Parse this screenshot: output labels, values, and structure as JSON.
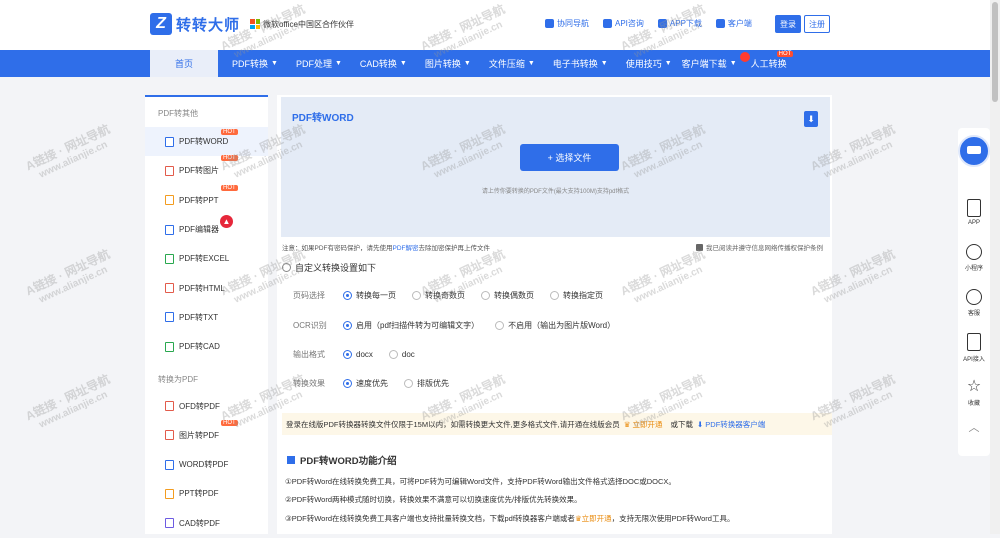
{
  "brand": {
    "logo_letter": "Z",
    "name": "转转大师",
    "partner": "微软office中国区合作伙伴"
  },
  "top_links": [
    "协同导航",
    "API咨询",
    "APP下载",
    "客户端"
  ],
  "auth": {
    "login": "登录",
    "register": "注册"
  },
  "nav": {
    "home": "首页",
    "items": [
      "PDF转换",
      "PDF处理",
      "CAD转换",
      "图片转换",
      "文件压缩",
      "电子书转换",
      "使用技巧",
      "客户端下载",
      "人工转换"
    ],
    "hot_label": "HOT"
  },
  "sidebar": {
    "section1": "PDF转其他",
    "items1": [
      {
        "label": "PDF转WORD",
        "badge": "HOT"
      },
      {
        "label": "PDF转图片",
        "badge": "HOT"
      },
      {
        "label": "PDF转PPT",
        "badge": "HOT"
      },
      {
        "label": "PDF编辑器",
        "badge": "flame"
      },
      {
        "label": "PDF转EXCEL",
        "badge": ""
      },
      {
        "label": "PDF转HTML",
        "badge": ""
      },
      {
        "label": "PDF转TXT",
        "badge": ""
      },
      {
        "label": "PDF转CAD",
        "badge": ""
      }
    ],
    "section2": "转换为PDF",
    "items2": [
      {
        "label": "OFD转PDF",
        "badge": ""
      },
      {
        "label": "图片转PDF",
        "badge": "HOT"
      },
      {
        "label": "WORD转PDF",
        "badge": ""
      },
      {
        "label": "PPT转PDF",
        "badge": ""
      },
      {
        "label": "CAD转PDF",
        "badge": ""
      }
    ]
  },
  "upload": {
    "title": "PDF转WORD",
    "button": "+ 选择文件",
    "hint": "请上传你要转换的PDF文件(最大支持100M)支持pdf格式"
  },
  "note": {
    "prefix": "注意：如果PDF有密码保护，请先使用",
    "link": "PDF解密",
    "suffix": "去除加密保护再上传文件",
    "agree": "我已阅读并遵守信息网络传播权保护条例"
  },
  "settings": {
    "title": "自定义转换设置如下",
    "rows": [
      {
        "label": "页码选择",
        "options": [
          "转换每一页",
          "转换奇数页",
          "转换偶数页",
          "转换指定页"
        ],
        "selected": 0
      },
      {
        "label": "OCR识别",
        "options": [
          "启用（pdf扫描件转为可编辑文字）",
          "不启用（输出为图片版Word）"
        ],
        "selected": 0
      },
      {
        "label": "输出格式",
        "options": [
          "docx",
          "doc"
        ],
        "selected": 0
      },
      {
        "label": "转换效果",
        "options": [
          "速度优先",
          "排版优先"
        ],
        "selected": 0
      }
    ]
  },
  "promo": {
    "text": "登录在线版PDF转换器转换文件仅限于15M以内，如需转换更大文件,更多格式文件,请开通在线版会员",
    "open": "立即开通",
    "or": "或下载",
    "client": "PDF转换器客户端"
  },
  "intro": {
    "title": "PDF转WORD功能介绍",
    "lines": [
      "①PDF转Word在线转换免费工具，可将PDF转为可编辑Word文件，支持PDF转Word输出文件格式选择DOC或DOCX。",
      "②PDF转Word两种模式随时切换，转换效果不满意可以切换速度优先/排版优先转换效果。"
    ],
    "line3_prefix": "③PDF转Word在线转换免费工具客户端也支持批量转换文档，下载pdf转换器客户端或者",
    "line3_open": "立即开通",
    "line3_suffix": "，支持无限次使用PDF转Word工具。"
  },
  "rightbar": [
    "APP",
    "小程序",
    "客服",
    "API接入",
    "收藏"
  ],
  "watermark": {
    "cn": "A链接 · 网址导航",
    "url": "www.alianjie.cn"
  }
}
